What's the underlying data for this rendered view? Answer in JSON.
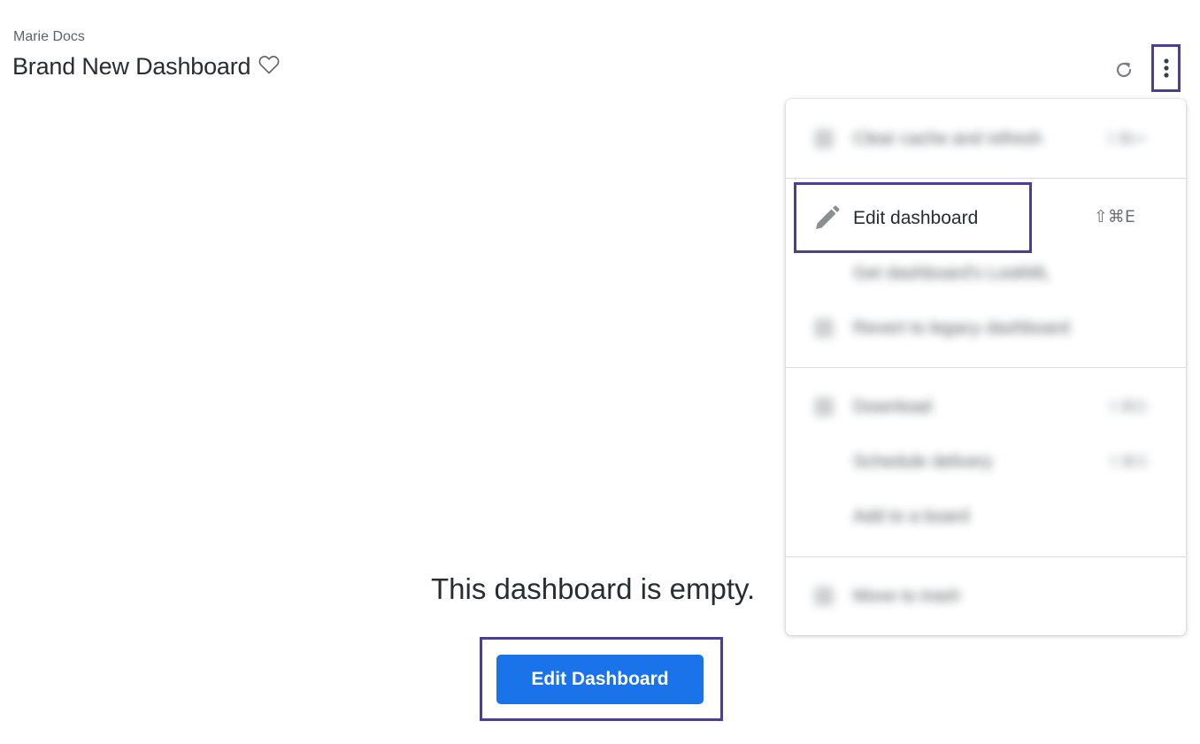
{
  "header": {
    "breadcrumb": "Marie Docs",
    "title": "Brand New Dashboard",
    "favorite_icon": "heart-outline-icon",
    "refresh_icon": "refresh-icon",
    "more_icon": "vertical-dots-icon"
  },
  "menu": {
    "blurred_items": [
      {
        "label": "Clear cache and refresh",
        "shortcut": "⇧⌘↩"
      },
      {
        "label": "Get dashboard's LookML",
        "shortcut": ""
      },
      {
        "label": "Revert to legacy dashboard",
        "shortcut": ""
      },
      {
        "label": "Download",
        "shortcut": "⇧⌘D"
      },
      {
        "label": "Schedule delivery",
        "shortcut": "⇧⌘S"
      },
      {
        "label": "Add to a board",
        "shortcut": ""
      },
      {
        "label": "Move to trash",
        "shortcut": ""
      }
    ],
    "edit_item": {
      "label": "Edit dashboard",
      "shortcut": "⇧⌘E",
      "icon": "pencil-icon"
    }
  },
  "main": {
    "empty_message": "This dashboard is empty.",
    "edit_button_label": "Edit Dashboard"
  },
  "colors": {
    "accent": "#1a73e8",
    "highlight_border": "#4c3f8c"
  }
}
